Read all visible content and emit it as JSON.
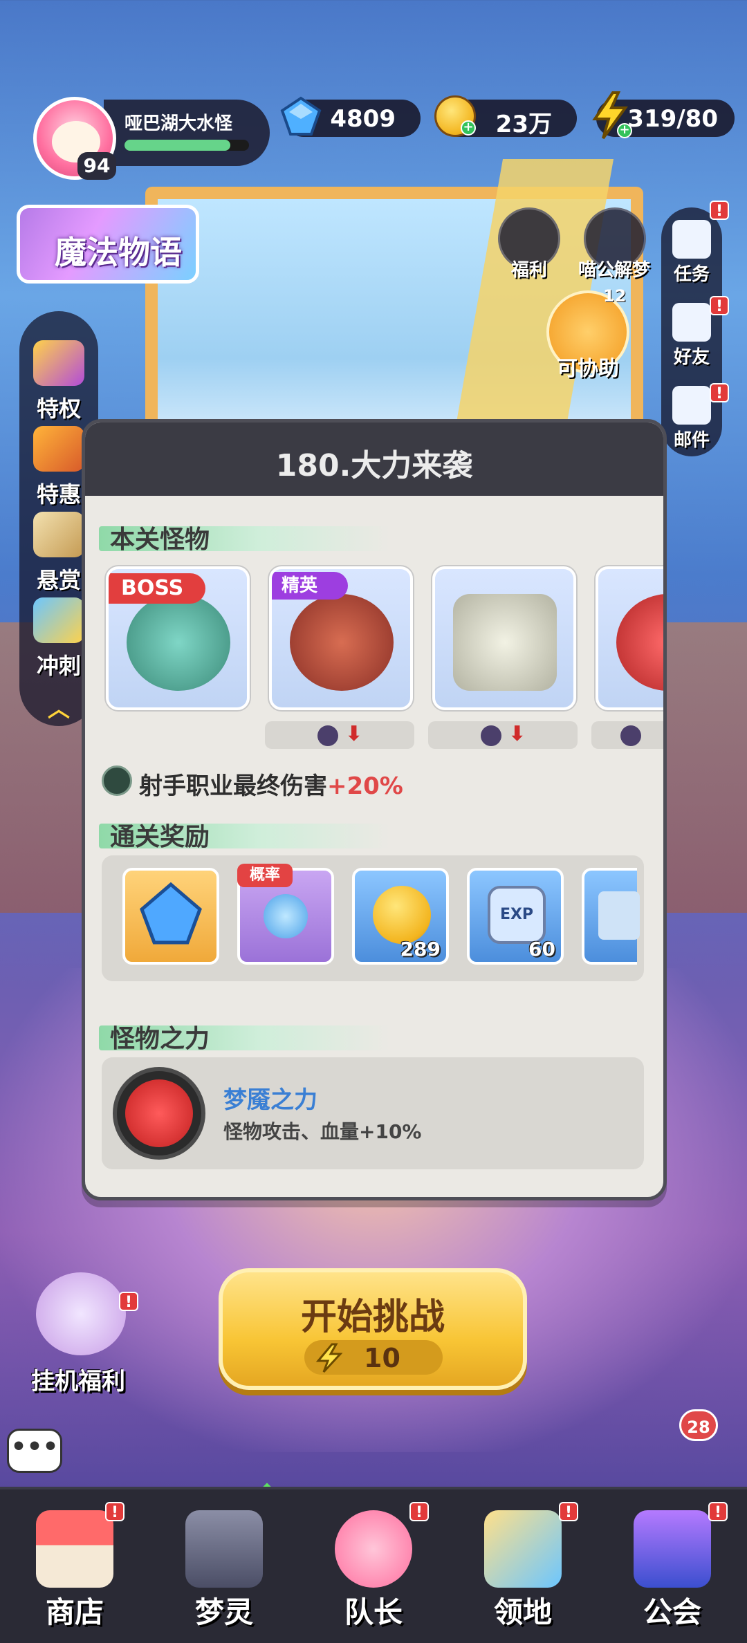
{
  "player": {
    "name": "哑巴湖大水怪",
    "level": "94",
    "hp_fraction": 0.85
  },
  "resources": {
    "gems": "4809",
    "coins": "23万",
    "energy": "319/80"
  },
  "event_banner": {
    "title": "魔法物语"
  },
  "left_rail": [
    {
      "label": "特权",
      "icon": "ticket-icon"
    },
    {
      "label": "特惠",
      "icon": "gift-box-icon"
    },
    {
      "label": "悬赏",
      "icon": "wanted-poster-icon"
    },
    {
      "label": "冲刺",
      "icon": "rank-trophy-icon"
    }
  ],
  "top_icons": [
    {
      "label": "福利",
      "icon": "gift-icon"
    },
    {
      "label": "喵公解梦",
      "icon": "cat-icon"
    }
  ],
  "assist": {
    "label": "可协助",
    "count": "12"
  },
  "right_rail": [
    {
      "label": "任务",
      "icon": "task-icon",
      "alert": "!"
    },
    {
      "label": "好友",
      "icon": "friends-icon",
      "alert": "!"
    },
    {
      "label": "邮件",
      "icon": "mail-icon",
      "alert": "!"
    }
  ],
  "modal": {
    "title": "180.大力来袭",
    "monsters_section": "本关怪物",
    "monsters": [
      {
        "tag": "BOSS",
        "tag_color": "#e23e3e"
      },
      {
        "tag": "精英",
        "tag_color": "#9d3ee0"
      },
      {
        "tag": ""
      },
      {
        "tag": ""
      }
    ],
    "bonus_text": "射手职业最终伤害",
    "bonus_value": "+20%",
    "rewards_section": "通关奖励",
    "rewards": [
      {
        "icon": "blue-gem-icon",
        "count": "",
        "tag": ""
      },
      {
        "icon": "orb-trophy-icon",
        "count": "",
        "tag": "概率"
      },
      {
        "icon": "gold-coin-icon",
        "count": "289",
        "tag": ""
      },
      {
        "icon": "exp-badge-icon",
        "count": "60",
        "tag": ""
      },
      {
        "icon": "map-scroll-icon",
        "count": "",
        "tag": ""
      }
    ],
    "power_section": "怪物之力",
    "power_name": "梦魇之力",
    "power_desc": "怪物攻击、血量+10%"
  },
  "start_button": {
    "label": "开始挑战",
    "cost": "10"
  },
  "idle": {
    "label": "挂机福利",
    "alert": "!"
  },
  "message_count": "28",
  "chat_label": "•••",
  "bottom_nav": [
    {
      "label": "商店",
      "icon": "shop-icon",
      "alert": "!"
    },
    {
      "label": "梦灵",
      "icon": "robot-icon",
      "alert": ""
    },
    {
      "label": "队长",
      "icon": "captain-icon",
      "alert": "!"
    },
    {
      "label": "领地",
      "icon": "territory-icon",
      "alert": "!"
    },
    {
      "label": "公会",
      "icon": "guild-icon",
      "alert": "!"
    }
  ],
  "colors": {
    "accent_gold": "#f8c535",
    "alert_red": "#e23a3a",
    "bonus_red": "#e04848",
    "power_blue": "#3a7fd4"
  }
}
